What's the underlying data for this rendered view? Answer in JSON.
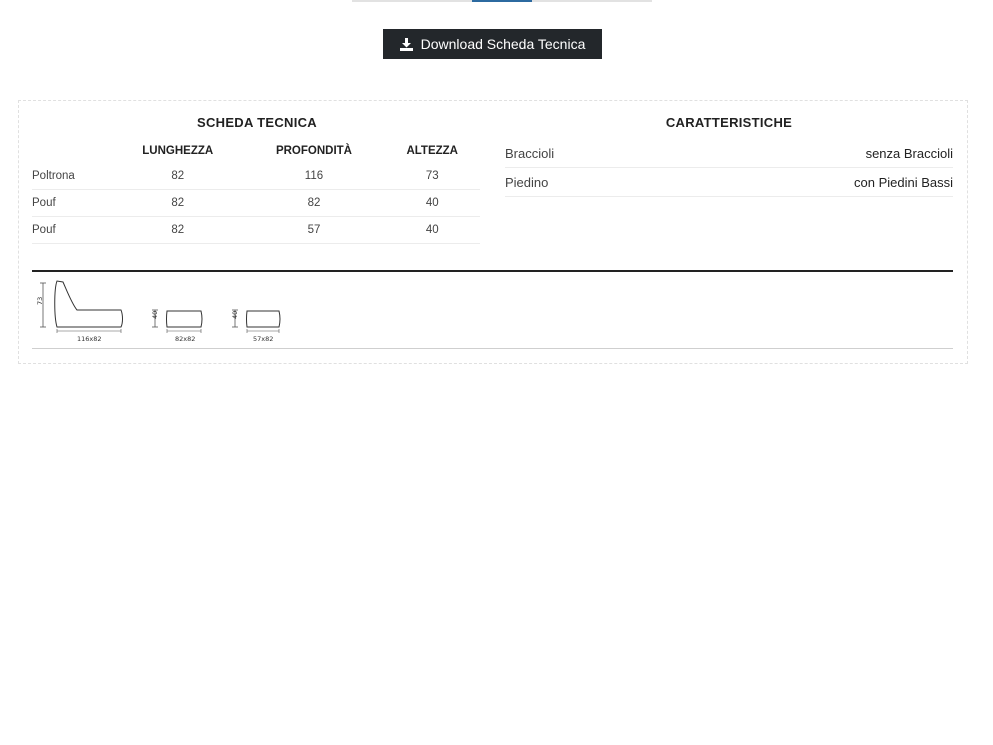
{
  "download_button": {
    "label": "Download Scheda Tecnica",
    "icon": "download-icon"
  },
  "spec_sheet": {
    "title": "SCHEDA TECNICA",
    "columns": [
      "",
      "LUNGHEZZA",
      "PROFONDITÀ",
      "ALTEZZA"
    ],
    "rows": [
      {
        "name": "Poltrona",
        "length": "82",
        "depth": "116",
        "height": "73"
      },
      {
        "name": "Pouf",
        "length": "82",
        "depth": "82",
        "height": "40"
      },
      {
        "name": "Pouf",
        "length": "82",
        "depth": "57",
        "height": "40"
      }
    ]
  },
  "features": {
    "title": "CARATTERISTICHE",
    "items": [
      {
        "label": "Braccioli",
        "value": "senza Braccioli"
      },
      {
        "label": "Piedino",
        "value": "con Piedini Bassi"
      }
    ]
  },
  "drawings": [
    {
      "height_label": "73",
      "size_label": "116x82"
    },
    {
      "height_label": "40",
      "size_label": "82x82"
    },
    {
      "height_label": "40",
      "size_label": "57x82"
    }
  ]
}
